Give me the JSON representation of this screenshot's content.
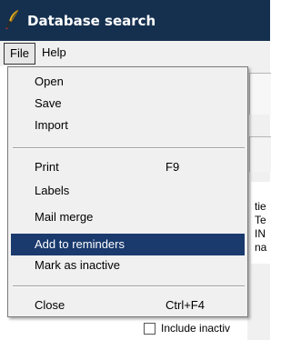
{
  "window": {
    "title": "Database search",
    "icon": "feather-quill-icon",
    "titlebar_color": "#15304f"
  },
  "menubar": {
    "file_label": "File",
    "help_label": "Help"
  },
  "file_menu": {
    "items": [
      {
        "label": "Open",
        "shortcut": ""
      },
      {
        "label": "Save",
        "shortcut": ""
      },
      {
        "label": "Import",
        "shortcut": ""
      },
      {
        "label": "Print",
        "shortcut": "F9"
      },
      {
        "label": "Labels",
        "shortcut": ""
      },
      {
        "label": "Mail merge",
        "shortcut": ""
      },
      {
        "label": "Add to reminders",
        "shortcut": "",
        "highlighted": true
      },
      {
        "label": "Mark as inactive",
        "shortcut": ""
      },
      {
        "label": "Close",
        "shortcut": "Ctrl+F4"
      }
    ],
    "highlight_color": "#1a3a6e"
  },
  "background": {
    "text_lines": [
      "tie",
      "Te",
      "IN",
      "na"
    ],
    "include_inactive_label": "Include inactiv"
  }
}
